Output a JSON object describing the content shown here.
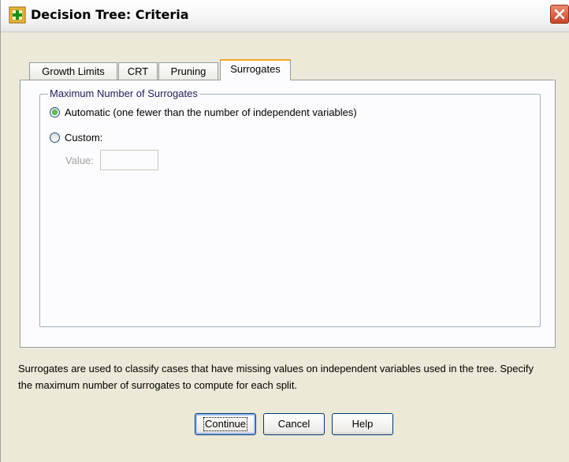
{
  "window": {
    "title": "Decision Tree: Criteria",
    "icon": "decision-tree-app-icon",
    "close_icon": "close-icon"
  },
  "tabs": [
    {
      "label": "Growth Limits",
      "active": false
    },
    {
      "label": "CRT",
      "active": false
    },
    {
      "label": "Pruning",
      "active": false
    },
    {
      "label": "Surrogates",
      "active": true
    }
  ],
  "surrogates": {
    "group_title": "Maximum Number of Surrogates",
    "options": [
      {
        "label": "Automatic (one fewer than the number of independent variables)",
        "checked": true
      },
      {
        "label": "Custom:",
        "checked": false
      }
    ],
    "value_label": "Value:",
    "value": "",
    "value_enabled": false
  },
  "description": "Surrogates are used to classify cases that have missing values on independent variables used in the tree. Specify the maximum number of surrogates to compute for each split.",
  "buttons": {
    "continue": "Continue",
    "cancel": "Cancel",
    "help": "Help"
  },
  "colors": {
    "dialog_bg": "#ece9d8",
    "panel_bg": "#fcfcfe",
    "active_tab_accent": "#f5a623",
    "close_button": "#c9462a"
  }
}
